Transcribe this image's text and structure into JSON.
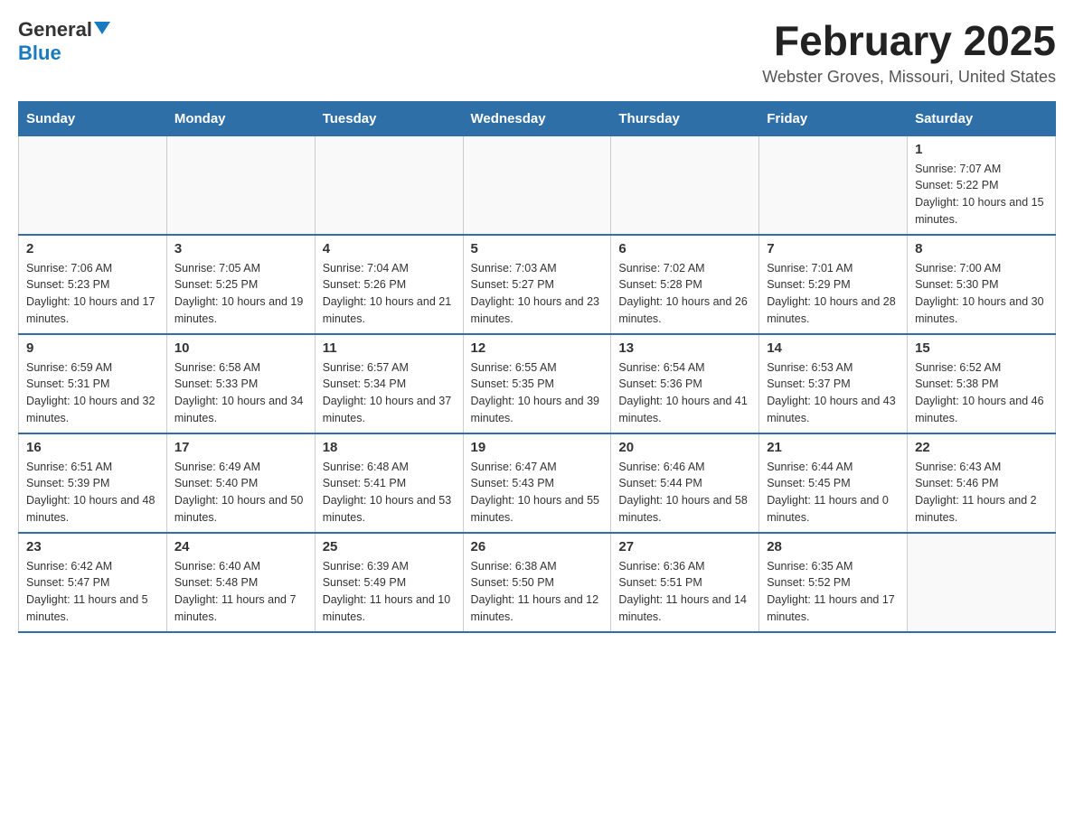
{
  "header": {
    "logo": {
      "general": "General",
      "blue": "Blue"
    },
    "title": "February 2025",
    "location": "Webster Groves, Missouri, United States"
  },
  "calendar": {
    "days_of_week": [
      "Sunday",
      "Monday",
      "Tuesday",
      "Wednesday",
      "Thursday",
      "Friday",
      "Saturday"
    ],
    "weeks": [
      [
        {
          "day": "",
          "info": ""
        },
        {
          "day": "",
          "info": ""
        },
        {
          "day": "",
          "info": ""
        },
        {
          "day": "",
          "info": ""
        },
        {
          "day": "",
          "info": ""
        },
        {
          "day": "",
          "info": ""
        },
        {
          "day": "1",
          "info": "Sunrise: 7:07 AM\nSunset: 5:22 PM\nDaylight: 10 hours and 15 minutes."
        }
      ],
      [
        {
          "day": "2",
          "info": "Sunrise: 7:06 AM\nSunset: 5:23 PM\nDaylight: 10 hours and 17 minutes."
        },
        {
          "day": "3",
          "info": "Sunrise: 7:05 AM\nSunset: 5:25 PM\nDaylight: 10 hours and 19 minutes."
        },
        {
          "day": "4",
          "info": "Sunrise: 7:04 AM\nSunset: 5:26 PM\nDaylight: 10 hours and 21 minutes."
        },
        {
          "day": "5",
          "info": "Sunrise: 7:03 AM\nSunset: 5:27 PM\nDaylight: 10 hours and 23 minutes."
        },
        {
          "day": "6",
          "info": "Sunrise: 7:02 AM\nSunset: 5:28 PM\nDaylight: 10 hours and 26 minutes."
        },
        {
          "day": "7",
          "info": "Sunrise: 7:01 AM\nSunset: 5:29 PM\nDaylight: 10 hours and 28 minutes."
        },
        {
          "day": "8",
          "info": "Sunrise: 7:00 AM\nSunset: 5:30 PM\nDaylight: 10 hours and 30 minutes."
        }
      ],
      [
        {
          "day": "9",
          "info": "Sunrise: 6:59 AM\nSunset: 5:31 PM\nDaylight: 10 hours and 32 minutes."
        },
        {
          "day": "10",
          "info": "Sunrise: 6:58 AM\nSunset: 5:33 PM\nDaylight: 10 hours and 34 minutes."
        },
        {
          "day": "11",
          "info": "Sunrise: 6:57 AM\nSunset: 5:34 PM\nDaylight: 10 hours and 37 minutes."
        },
        {
          "day": "12",
          "info": "Sunrise: 6:55 AM\nSunset: 5:35 PM\nDaylight: 10 hours and 39 minutes."
        },
        {
          "day": "13",
          "info": "Sunrise: 6:54 AM\nSunset: 5:36 PM\nDaylight: 10 hours and 41 minutes."
        },
        {
          "day": "14",
          "info": "Sunrise: 6:53 AM\nSunset: 5:37 PM\nDaylight: 10 hours and 43 minutes."
        },
        {
          "day": "15",
          "info": "Sunrise: 6:52 AM\nSunset: 5:38 PM\nDaylight: 10 hours and 46 minutes."
        }
      ],
      [
        {
          "day": "16",
          "info": "Sunrise: 6:51 AM\nSunset: 5:39 PM\nDaylight: 10 hours and 48 minutes."
        },
        {
          "day": "17",
          "info": "Sunrise: 6:49 AM\nSunset: 5:40 PM\nDaylight: 10 hours and 50 minutes."
        },
        {
          "day": "18",
          "info": "Sunrise: 6:48 AM\nSunset: 5:41 PM\nDaylight: 10 hours and 53 minutes."
        },
        {
          "day": "19",
          "info": "Sunrise: 6:47 AM\nSunset: 5:43 PM\nDaylight: 10 hours and 55 minutes."
        },
        {
          "day": "20",
          "info": "Sunrise: 6:46 AM\nSunset: 5:44 PM\nDaylight: 10 hours and 58 minutes."
        },
        {
          "day": "21",
          "info": "Sunrise: 6:44 AM\nSunset: 5:45 PM\nDaylight: 11 hours and 0 minutes."
        },
        {
          "day": "22",
          "info": "Sunrise: 6:43 AM\nSunset: 5:46 PM\nDaylight: 11 hours and 2 minutes."
        }
      ],
      [
        {
          "day": "23",
          "info": "Sunrise: 6:42 AM\nSunset: 5:47 PM\nDaylight: 11 hours and 5 minutes."
        },
        {
          "day": "24",
          "info": "Sunrise: 6:40 AM\nSunset: 5:48 PM\nDaylight: 11 hours and 7 minutes."
        },
        {
          "day": "25",
          "info": "Sunrise: 6:39 AM\nSunset: 5:49 PM\nDaylight: 11 hours and 10 minutes."
        },
        {
          "day": "26",
          "info": "Sunrise: 6:38 AM\nSunset: 5:50 PM\nDaylight: 11 hours and 12 minutes."
        },
        {
          "day": "27",
          "info": "Sunrise: 6:36 AM\nSunset: 5:51 PM\nDaylight: 11 hours and 14 minutes."
        },
        {
          "day": "28",
          "info": "Sunrise: 6:35 AM\nSunset: 5:52 PM\nDaylight: 11 hours and 17 minutes."
        },
        {
          "day": "",
          "info": ""
        }
      ]
    ]
  }
}
